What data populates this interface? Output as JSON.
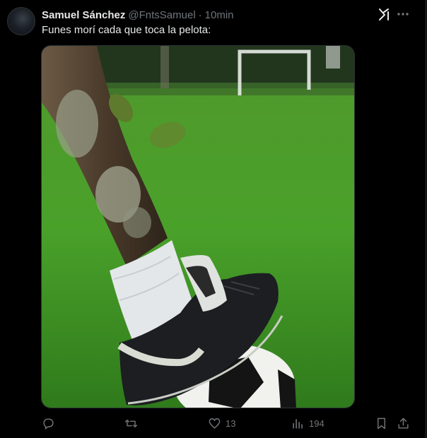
{
  "tweet": {
    "author_name": "Samuel Sánchez",
    "handle": "@FntsSamuel",
    "separator": "·",
    "time": "10min",
    "text": "Funes morí cada que toca la pelota:"
  },
  "icons": {
    "grok": "grok-icon",
    "more": "more-icon",
    "reply": "reply-icon",
    "retweet": "retweet-icon",
    "like": "heart-icon",
    "views": "views-icon",
    "bookmark": "bookmark-icon",
    "share": "share-icon"
  },
  "actions": {
    "like_count": "13",
    "view_count": "194"
  },
  "colors": {
    "background": "#000000",
    "text": "#e7e9ea",
    "muted": "#71767b"
  }
}
